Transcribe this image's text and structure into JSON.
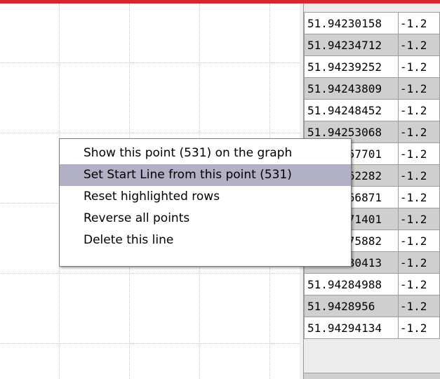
{
  "table": {
    "rows": [
      {
        "lat": "51.94230158",
        "lon": "-1.2"
      },
      {
        "lat": "51.94234712",
        "lon": "-1.2"
      },
      {
        "lat": "51.94239252",
        "lon": "-1.2"
      },
      {
        "lat": "51.94243809",
        "lon": "-1.2"
      },
      {
        "lat": "51.94248452",
        "lon": "-1.2"
      },
      {
        "lat": "51.94253068",
        "lon": "-1.2"
      },
      {
        "lat": "51.94257701",
        "lon": "-1.2"
      },
      {
        "lat": "51.94262282",
        "lon": "-1.2"
      },
      {
        "lat": "51.94266871",
        "lon": "-1.2"
      },
      {
        "lat": "51.94271401",
        "lon": "-1.2"
      },
      {
        "lat": "51.94275882",
        "lon": "-1.2"
      },
      {
        "lat": "51.94280413",
        "lon": "-1.2"
      },
      {
        "lat": "51.94284988",
        "lon": "-1.2"
      },
      {
        "lat": "51.9428956",
        "lon": "-1.2"
      },
      {
        "lat": "51.94294134",
        "lon": "-1.2"
      }
    ]
  },
  "context_menu": {
    "items": [
      {
        "label": "Show this point (531) on the graph"
      },
      {
        "label": "Set Start Line from this point (531)"
      },
      {
        "label": "Reset highlighted rows"
      },
      {
        "label": "Reverse all points"
      },
      {
        "label": "Delete this line"
      }
    ],
    "active_index": 1
  },
  "colors": {
    "accent_bar": "#d7262f",
    "menu_highlight": "#b1b0c4",
    "row_alt": "#cfcfcf"
  }
}
